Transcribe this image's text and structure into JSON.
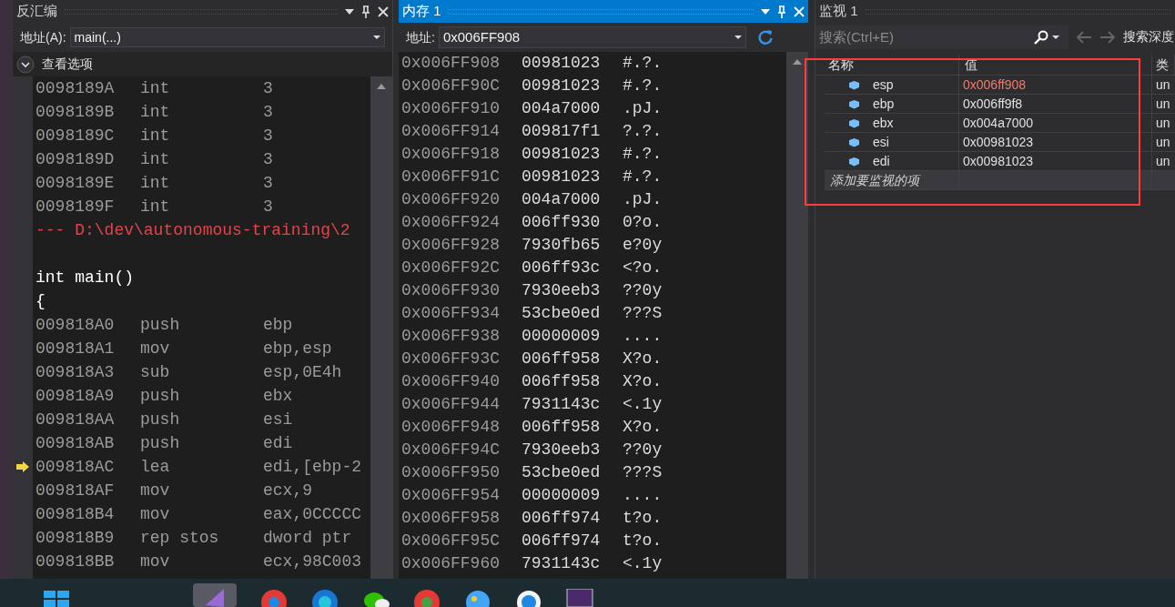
{
  "disassembly": {
    "title": "反汇编",
    "address_label": "地址(A):",
    "address_value": "main(...)",
    "options_label": "查看选项",
    "lines": [
      {
        "kind": "instr",
        "address": "0098189A",
        "mnemonic": "int",
        "operands": "3",
        "current": false
      },
      {
        "kind": "instr",
        "address": "0098189B",
        "mnemonic": "int",
        "operands": "3",
        "current": false
      },
      {
        "kind": "instr",
        "address": "0098189C",
        "mnemonic": "int",
        "operands": "3",
        "current": false
      },
      {
        "kind": "instr",
        "address": "0098189D",
        "mnemonic": "int",
        "operands": "3",
        "current": false
      },
      {
        "kind": "instr",
        "address": "0098189E",
        "mnemonic": "int",
        "operands": "3",
        "current": false
      },
      {
        "kind": "instr",
        "address": "0098189F",
        "mnemonic": "int",
        "operands": "3",
        "current": false
      },
      {
        "kind": "source",
        "text": "--- D:\\dev\\autonomous-training\\2"
      },
      {
        "kind": "blank"
      },
      {
        "kind": "code",
        "text": "int main()"
      },
      {
        "kind": "code",
        "text": "{"
      },
      {
        "kind": "instr",
        "address": "009818A0",
        "mnemonic": "push",
        "operands": "ebp",
        "current": false
      },
      {
        "kind": "instr",
        "address": "009818A1",
        "mnemonic": "mov",
        "operands": "ebp,esp",
        "current": false
      },
      {
        "kind": "instr",
        "address": "009818A3",
        "mnemonic": "sub",
        "operands": "esp,0E4h",
        "current": false
      },
      {
        "kind": "instr",
        "address": "009818A9",
        "mnemonic": "push",
        "operands": "ebx",
        "current": false
      },
      {
        "kind": "instr",
        "address": "009818AA",
        "mnemonic": "push",
        "operands": "esi",
        "current": false
      },
      {
        "kind": "instr",
        "address": "009818AB",
        "mnemonic": "push",
        "operands": "edi",
        "current": false
      },
      {
        "kind": "instr",
        "address": "009818AC",
        "mnemonic": "lea",
        "operands": "edi,[ebp-2",
        "current": true
      },
      {
        "kind": "instr",
        "address": "009818AF",
        "mnemonic": "mov",
        "operands": "ecx,9",
        "current": false
      },
      {
        "kind": "instr",
        "address": "009818B4",
        "mnemonic": "mov",
        "operands": "eax,0CCCCC",
        "current": false
      },
      {
        "kind": "instr",
        "address": "009818B9",
        "mnemonic": "rep stos",
        "operands": "dword ptr",
        "current": false
      },
      {
        "kind": "instr",
        "address": "009818BB",
        "mnemonic": "mov",
        "operands": "ecx,98C003",
        "current": false
      }
    ]
  },
  "memory": {
    "title": "内存 1",
    "address_label": "地址:",
    "address_value": "0x006FF908",
    "rows": [
      {
        "address": "0x006FF908",
        "hex": "00981023",
        "ascii": "#.?."
      },
      {
        "address": "0x006FF90C",
        "hex": "00981023",
        "ascii": "#.?."
      },
      {
        "address": "0x006FF910",
        "hex": "004a7000",
        "ascii": ".pJ."
      },
      {
        "address": "0x006FF914",
        "hex": "009817f1",
        "ascii": "?.?."
      },
      {
        "address": "0x006FF918",
        "hex": "00981023",
        "ascii": "#.?."
      },
      {
        "address": "0x006FF91C",
        "hex": "00981023",
        "ascii": "#.?."
      },
      {
        "address": "0x006FF920",
        "hex": "004a7000",
        "ascii": ".pJ."
      },
      {
        "address": "0x006FF924",
        "hex": "006ff930",
        "ascii": "0?o."
      },
      {
        "address": "0x006FF928",
        "hex": "7930fb65",
        "ascii": "e?0y"
      },
      {
        "address": "0x006FF92C",
        "hex": "006ff93c",
        "ascii": "<?o."
      },
      {
        "address": "0x006FF930",
        "hex": "7930eeb3",
        "ascii": "??0y"
      },
      {
        "address": "0x006FF934",
        "hex": "53cbe0ed",
        "ascii": "???S"
      },
      {
        "address": "0x006FF938",
        "hex": "00000009",
        "ascii": "...."
      },
      {
        "address": "0x006FF93C",
        "hex": "006ff958",
        "ascii": "X?o."
      },
      {
        "address": "0x006FF940",
        "hex": "006ff958",
        "ascii": "X?o."
      },
      {
        "address": "0x006FF944",
        "hex": "7931143c",
        "ascii": "<.1y"
      },
      {
        "address": "0x006FF948",
        "hex": "006ff958",
        "ascii": "X?o."
      },
      {
        "address": "0x006FF94C",
        "hex": "7930eeb3",
        "ascii": "??0y"
      },
      {
        "address": "0x006FF950",
        "hex": "53cbe0ed",
        "ascii": "???S"
      },
      {
        "address": "0x006FF954",
        "hex": "00000009",
        "ascii": "...."
      },
      {
        "address": "0x006FF958",
        "hex": "006ff974",
        "ascii": "t?o."
      },
      {
        "address": "0x006FF95C",
        "hex": "006ff974",
        "ascii": "t?o."
      },
      {
        "address": "0x006FF960",
        "hex": "7931143c",
        "ascii": "<.1y"
      }
    ]
  },
  "watch": {
    "title": "监视 1",
    "search_placeholder": "搜索(Ctrl+E)",
    "search_depth_label": "搜索深度",
    "columns": [
      "名称",
      "值",
      "类"
    ],
    "rows": [
      {
        "name": "esp",
        "value": "0x006ff908",
        "type": "un",
        "changed": true
      },
      {
        "name": "ebp",
        "value": "0x006ff9f8",
        "type": "un",
        "changed": false
      },
      {
        "name": "ebx",
        "value": "0x004a7000",
        "type": "un",
        "changed": false
      },
      {
        "name": "esi",
        "value": "0x00981023",
        "type": "un",
        "changed": false
      },
      {
        "name": "edi",
        "value": "0x00981023",
        "type": "un",
        "changed": false
      }
    ],
    "add_item_placeholder": "添加要监视的项"
  }
}
